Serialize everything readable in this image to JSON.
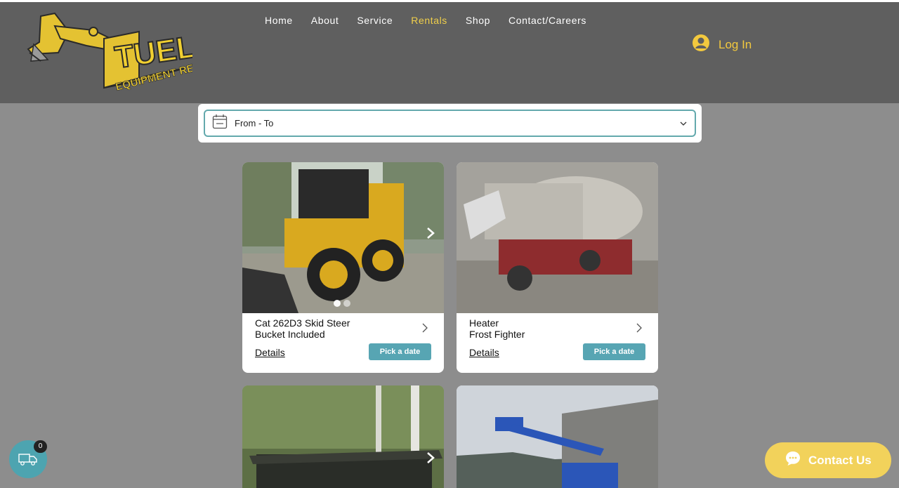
{
  "logo": {
    "line1": "TUEL'S",
    "line2": "EQUIPMENT REPAIR"
  },
  "nav": {
    "items": [
      {
        "label": "Home"
      },
      {
        "label": "About"
      },
      {
        "label": "Service"
      },
      {
        "label": "Rentals",
        "active": true
      },
      {
        "label": "Shop"
      },
      {
        "label": "Contact/Careers"
      }
    ]
  },
  "login": {
    "label": "Log In"
  },
  "date_picker": {
    "label": "From - To"
  },
  "rentals": [
    {
      "title_line1": "Cat 262D3 Skid Steer",
      "title_line2": "Bucket Included",
      "details": "Details",
      "button": "Pick a date"
    },
    {
      "title_line1": "Heater",
      "title_line2": "Frost Fighter",
      "details": "Details",
      "button": "Pick a date"
    }
  ],
  "cart": {
    "count": "0"
  },
  "contact": {
    "label": "Contact Us"
  },
  "colors": {
    "header": "#5f5f5f",
    "accent_yellow": "#f0cf4a",
    "teal": "#57a5b3",
    "page_bg": "#8d8d8d"
  }
}
